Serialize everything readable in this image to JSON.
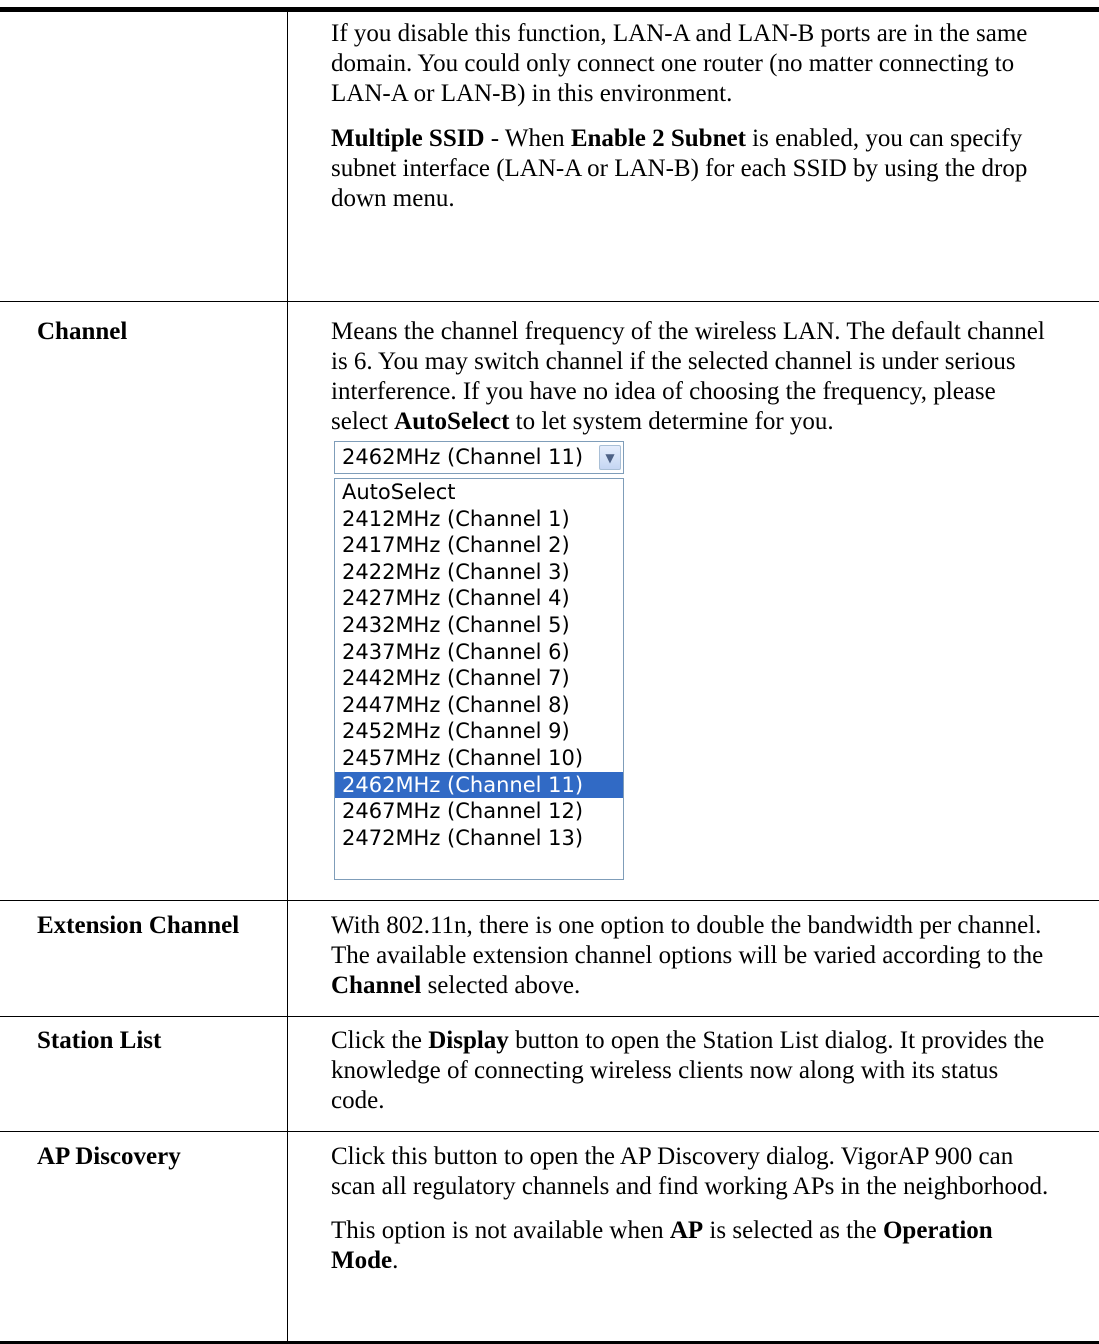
{
  "rows": [
    {
      "term": "",
      "paragraphs": [
        [
          {
            "t": "If you disable this function, LAN-A and LAN-B ports are in the same domain. You could only connect one router (no matter connecting to LAN-A or LAN-B) in this environment."
          }
        ],
        [
          {
            "t": "Multiple SSID",
            "b": true
          },
          {
            "t": " - When "
          },
          {
            "t": "Enable 2 Subnet",
            "b": true
          },
          {
            "t": " is enabled, you can specify subnet interface (LAN-A or LAN-B) for each SSID by using the drop down menu."
          }
        ]
      ]
    },
    {
      "term": "Channel",
      "paragraphs": [
        [
          {
            "t": "Means the channel frequency of the wireless LAN. The default channel is 6. You may switch channel if the selected channel is under serious interference. If you have no idea of choosing the frequency, please select "
          },
          {
            "t": "AutoSelect",
            "b": true
          },
          {
            "t": " to let system determine for you."
          }
        ]
      ]
    },
    {
      "term": "Extension Channel",
      "paragraphs": [
        [
          {
            "t": "With 802.11n, there is one option to double the bandwidth per channel. The available extension channel options will be varied according to the "
          },
          {
            "t": "Channel",
            "b": true
          },
          {
            "t": " selected above."
          }
        ]
      ]
    },
    {
      "term": "Station List",
      "paragraphs": [
        [
          {
            "t": "Click the "
          },
          {
            "t": "Display",
            "b": true
          },
          {
            "t": " button to open the Station List dialog. It provides the knowledge of connecting wireless clients now along with its status code."
          }
        ]
      ]
    },
    {
      "term": "AP Discovery",
      "paragraphs": [
        [
          {
            "t": "Click this button to open the AP Discovery dialog. VigorAP 900 can scan all regulatory channels and find working APs in the neighborhood."
          }
        ],
        [
          {
            "t": "This option is not available when "
          },
          {
            "t": "AP",
            "b": true
          },
          {
            "t": " is selected as the "
          },
          {
            "t": "Operation Mode",
            "b": true
          },
          {
            "t": "."
          }
        ]
      ]
    }
  ],
  "channel_select": {
    "selected": "2462MHz (Channel 11)",
    "arrow_icon": "chevron-down-icon",
    "options": [
      "AutoSelect",
      "2412MHz (Channel 1)",
      "2417MHz (Channel 2)",
      "2422MHz (Channel 3)",
      "2427MHz (Channel 4)",
      "2432MHz (Channel 5)",
      "2437MHz (Channel 6)",
      "2442MHz (Channel 7)",
      "2447MHz (Channel 8)",
      "2452MHz (Channel 9)",
      "2457MHz (Channel 10)",
      "2462MHz (Channel 11)",
      "2467MHz (Channel 12)",
      "2472MHz (Channel 13)"
    ],
    "highlight_color": "#316ac5"
  }
}
